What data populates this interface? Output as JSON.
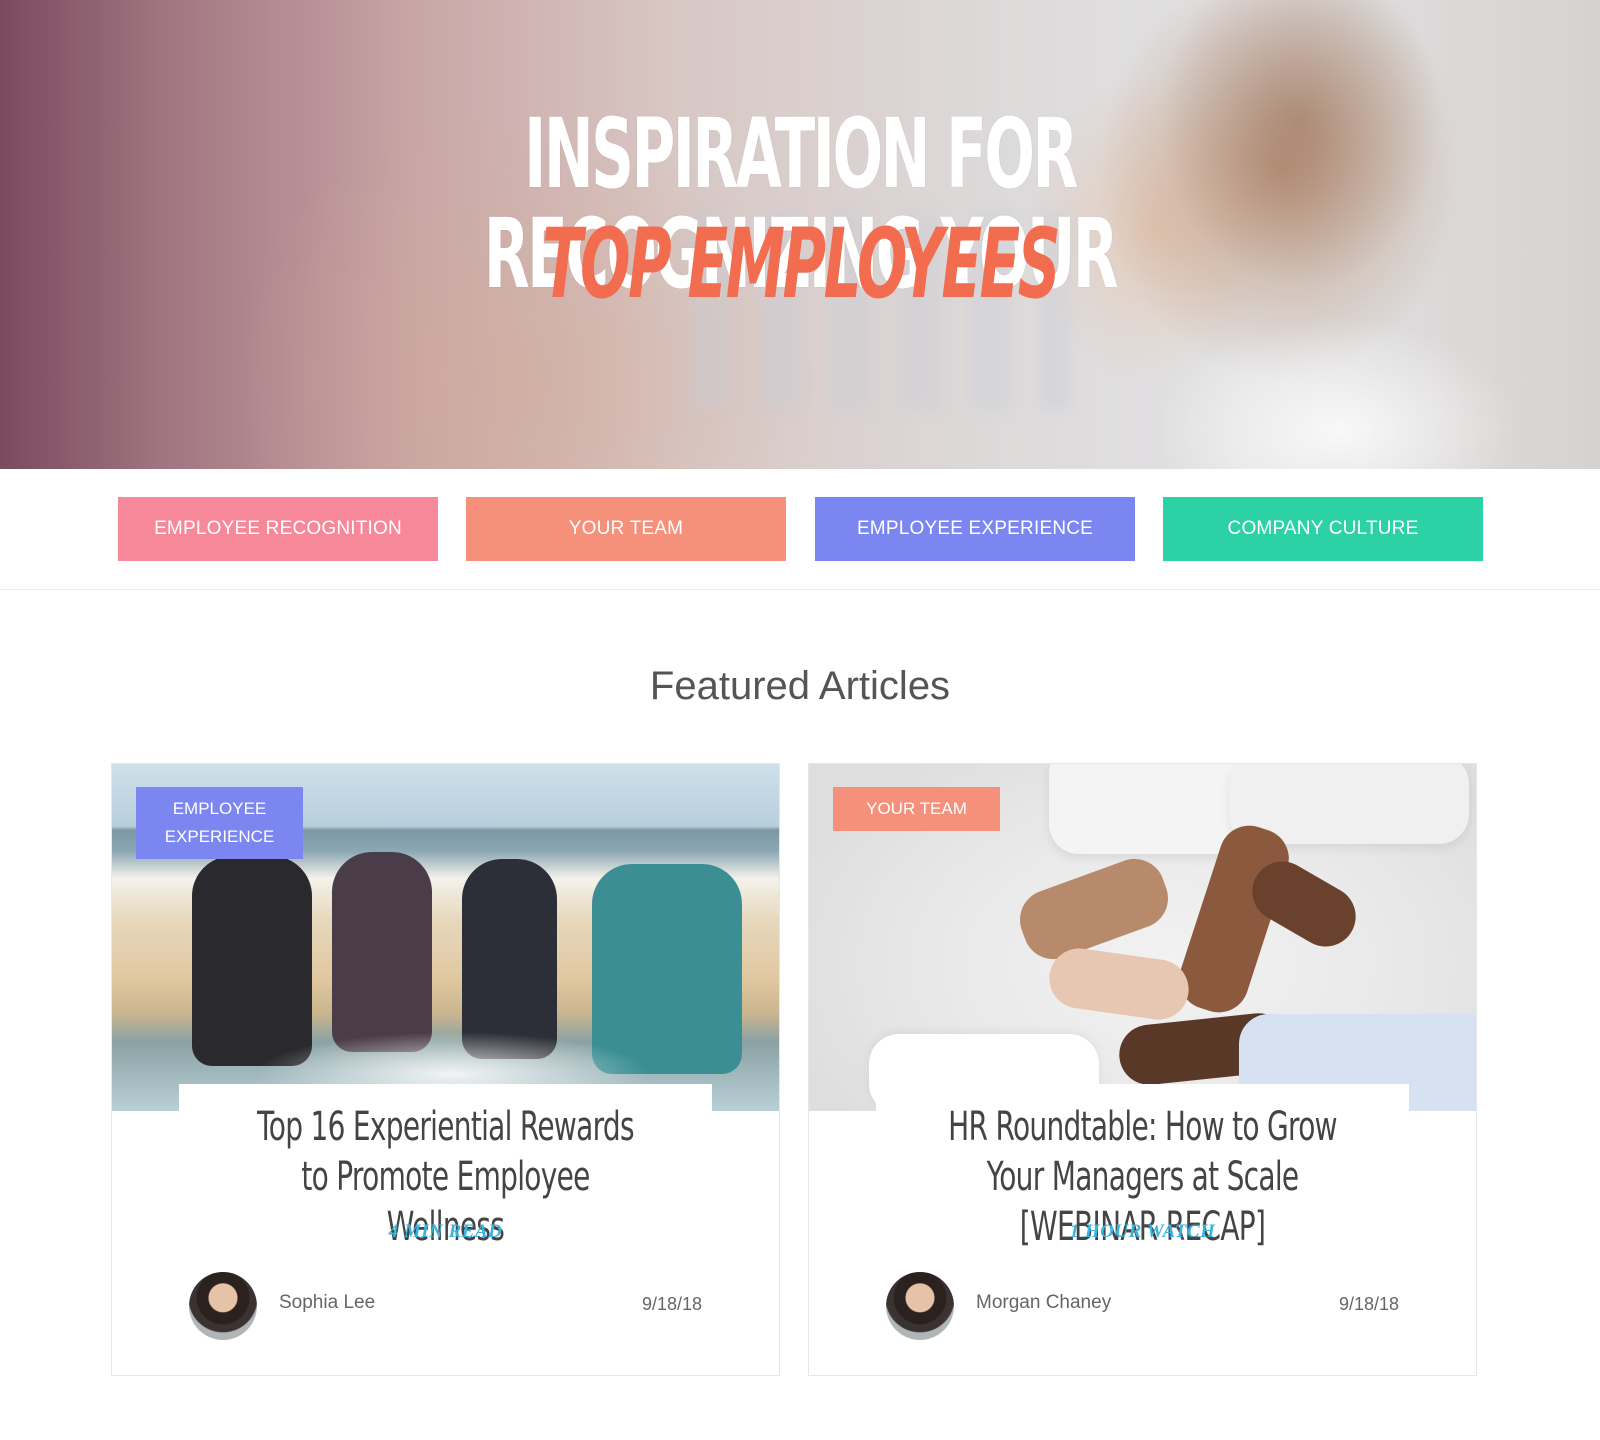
{
  "hero": {
    "title_line1": "INSPIRATION FOR RECOGNIZING YOUR",
    "title_line2": "TOP EMPLOYEES"
  },
  "categories": [
    {
      "label": "EMPLOYEE RECOGNITION",
      "color": "#f7889a"
    },
    {
      "label": "YOUR TEAM",
      "color": "#f5917b"
    },
    {
      "label": "EMPLOYEE EXPERIENCE",
      "color": "#7b86f1"
    },
    {
      "label": "COMPANY CULTURE",
      "color": "#2dd1a6"
    }
  ],
  "featured": {
    "heading": "Featured Articles",
    "articles": [
      {
        "tag_line1": "EMPLOYEE",
        "tag_line2": "EXPERIENCE",
        "tag_color": "#7b86f1",
        "title": "Top 16 Experiential Rewards to Promote Employee Wellness",
        "read_time": "4 MIN READ",
        "author": "Sophia Lee",
        "date": "9/18/18"
      },
      {
        "tag": "YOUR TEAM",
        "tag_color": "#f5917b",
        "title": "HR Roundtable: How to Grow Your Managers at Scale [WEBINAR RECAP]",
        "read_time": "1 HOUR WATCH",
        "author": "Morgan Chaney",
        "date": "9/18/18"
      }
    ]
  },
  "accent_colors": {
    "hero_highlight": "#f26c4f",
    "read_time": "#39b3df"
  }
}
